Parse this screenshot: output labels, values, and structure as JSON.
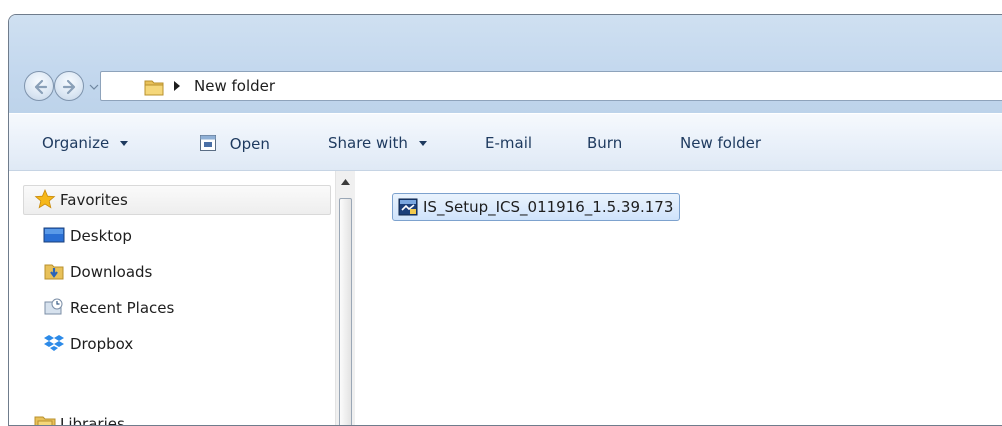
{
  "address_bar": {
    "breadcrumb": "New folder"
  },
  "toolbar": {
    "organize": "Organize",
    "open": "Open",
    "share_with": "Share with",
    "email": "E-mail",
    "burn": "Burn",
    "new_folder": "New folder"
  },
  "nav_pane": {
    "items": [
      {
        "label": "Favorites",
        "icon": "star-icon"
      },
      {
        "label": "Desktop",
        "icon": "desktop-icon"
      },
      {
        "label": "Downloads",
        "icon": "downloads-folder-icon"
      },
      {
        "label": "Recent Places",
        "icon": "recent-places-icon"
      },
      {
        "label": "Dropbox",
        "icon": "dropbox-icon"
      },
      {
        "label": "Libraries",
        "icon": "libraries-icon"
      }
    ]
  },
  "content": {
    "files": [
      {
        "name": "IS_Setup_ICS_011916_1.5.39.173",
        "icon": "installer-icon"
      }
    ]
  },
  "colors": {
    "title_bar": "#c4d8ee",
    "toolbar_text": "#1e3a5f",
    "selection_fill": "#cfe3fb",
    "selection_border": "#7da2ce"
  }
}
